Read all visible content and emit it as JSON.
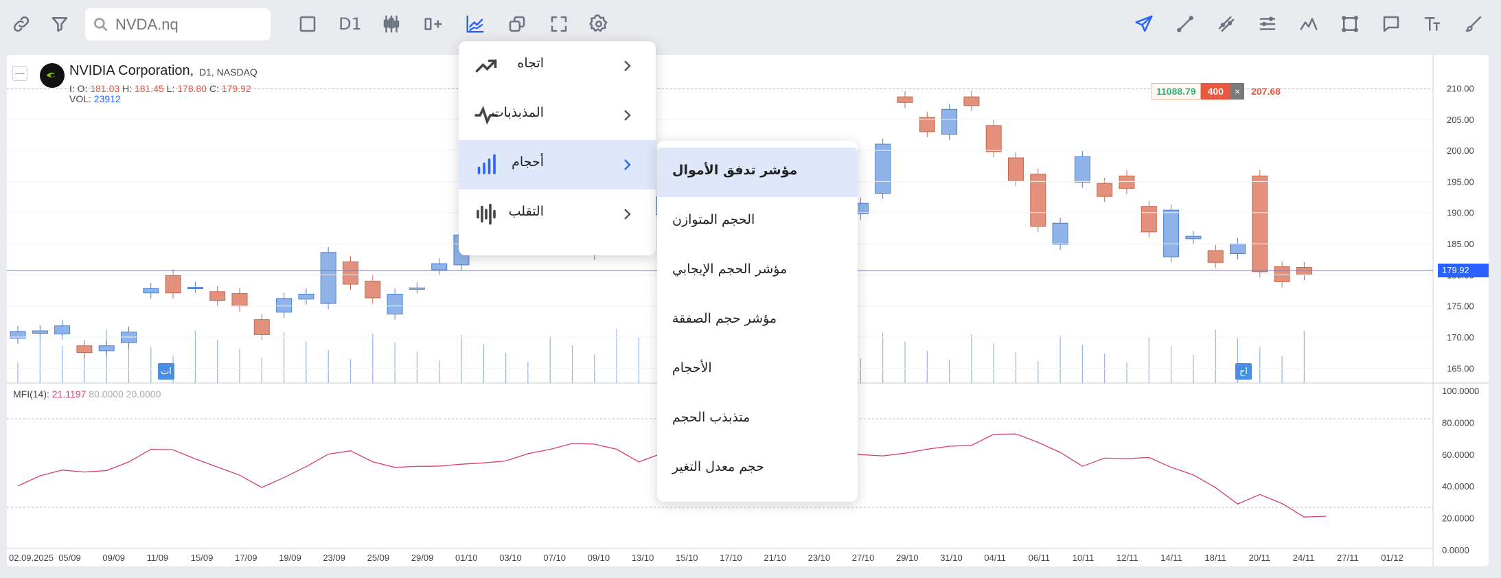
{
  "toolbar": {
    "search_placeholder": "NVDA.nq",
    "timeframe": "D1"
  },
  "legend": {
    "symbol_name": "NVIDIA Corporation,",
    "meta": "D1, NASDAQ",
    "ohlc": {
      "o_label": "I: O:",
      "o": "181.03",
      "h_label": "H:",
      "h": "181.45",
      "l_label": "L:",
      "l": "178.80",
      "c_label": "C:",
      "c": "179.92"
    },
    "vol_label": "VOL:",
    "vol": "23912"
  },
  "mfi_legend": {
    "label": "MFI(14):",
    "value": "21.1197",
    "upper": "80.0000",
    "lower": "20.0000"
  },
  "price_box": {
    "left": "11088.79",
    "qty": "400",
    "close": "×",
    "price": "207.68"
  },
  "current_price": "179.92",
  "tags": {
    "a": "ات",
    "b": "اح"
  },
  "menu_categories": [
    {
      "label": "اتجاه",
      "icon": "trend-icon"
    },
    {
      "label": "المذبذبات",
      "icon": "oscillator-icon"
    },
    {
      "label": "أحجام",
      "icon": "volume-bars-icon"
    },
    {
      "label": "التقلب",
      "icon": "volatility-icon"
    }
  ],
  "submenu_volume": [
    "مؤشر تدفق الأموال",
    "الحجم المتوازن",
    "مؤشر الحجم الإيجابي",
    "مؤشر حجم الصفقة",
    "الأحجام",
    "متذبذب الحجم",
    "حجم معدل التغير"
  ],
  "colors": {
    "accent": "#2962ff",
    "up": "#8fb3e8",
    "down": "#e3917c",
    "mfi": "#d63c7a"
  },
  "chart_data": {
    "type": "candlestick",
    "x_labels": [
      "02.09.2025",
      "05/09",
      "09/09",
      "11/09",
      "15/09",
      "17/09",
      "19/09",
      "23/09",
      "25/09",
      "29/09",
      "01/10",
      "03/10",
      "07/10",
      "09/10",
      "13/10",
      "15/10",
      "17/10",
      "21/10",
      "23/10",
      "27/10",
      "29/10",
      "31/10",
      "04/11",
      "06/11",
      "10/11",
      "12/11",
      "14/11",
      "18/11",
      "20/11",
      "24/11",
      "27/11",
      "01/12"
    ],
    "y_price_ticks": [
      "210.00",
      "205.00",
      "200.00",
      "195.00",
      "190.00",
      "185.00",
      "180.00",
      "175.00",
      "170.00",
      "165.00"
    ],
    "y_mfi_ticks": [
      "100.0000",
      "80.0000",
      "60.0000",
      "40.0000",
      "20.0000",
      "0.0000"
    ],
    "price_range": [
      162.5,
      212.7
    ],
    "mfi_range": [
      0,
      100
    ],
    "candles": [
      [
        169.8,
        170.9
      ],
      [
        170.6,
        171.0
      ],
      [
        170.5,
        171.8
      ],
      [
        168.6,
        167.5
      ],
      [
        167.8,
        168.6
      ],
      [
        169.1,
        170.8
      ],
      [
        177.1,
        177.8
      ],
      [
        179.9,
        177.1
      ],
      [
        178.0,
        178.0
      ],
      [
        177.3,
        175.9
      ],
      [
        177.0,
        175.0
      ],
      [
        172.8,
        170.4
      ],
      [
        174.0,
        176.2
      ],
      [
        176.1,
        176.9
      ],
      [
        175.4,
        183.6
      ],
      [
        182.1,
        178.5
      ],
      [
        179.0,
        176.3
      ],
      [
        173.7,
        176.9
      ],
      [
        177.9,
        177.9
      ],
      [
        180.8,
        181.8
      ],
      [
        181.6,
        186.4
      ],
      [
        184.8,
        185.4
      ],
      [
        186.7,
        188.3
      ],
      [
        188.3,
        187.2
      ],
      [
        185.5,
        186.8
      ],
      [
        186.9,
        187.1
      ],
      [
        183.3,
        186.1
      ],
      [
        186.5,
        186.3
      ],
      [
        190.1,
        186.4
      ],
      [
        189.7,
        192.5
      ],
      [
        191.2,
        191.8
      ],
      [
        193.6,
        193.8
      ],
      [
        194.1,
        194.0
      ],
      [
        193.8,
        195.2
      ],
      [
        191.5,
        190.0
      ],
      [
        190.0,
        190.5
      ],
      [
        191.7,
        187.8
      ],
      [
        189.5,
        189.6
      ],
      [
        189.8,
        191.5
      ],
      [
        193.1,
        201.0
      ],
      [
        208.6,
        207.7
      ],
      [
        205.3,
        203.0
      ],
      [
        202.6,
        206.6
      ],
      [
        208.6,
        207.2
      ],
      [
        204.0,
        199.8
      ],
      [
        198.8,
        195.2
      ],
      [
        196.2,
        187.8
      ],
      [
        184.9,
        188.3
      ],
      [
        194.9,
        199.0
      ],
      [
        194.7,
        192.6
      ],
      [
        195.9,
        193.9
      ],
      [
        191.0,
        186.9
      ],
      [
        182.9,
        190.4
      ],
      [
        185.8,
        186.2
      ],
      [
        183.9,
        182.0
      ],
      [
        183.4,
        185.0
      ],
      [
        195.9,
        180.5
      ],
      [
        181.3,
        178.9
      ],
      [
        181.2,
        180.0
      ]
    ],
    "mfi": [
      40.1,
      46.5,
      50.1,
      48.9,
      49.8,
      55.2,
      63.1,
      62.8,
      57.1,
      52.0,
      46.9,
      39.2,
      45.4,
      52.3,
      60.1,
      62.2,
      55.3,
      51.8,
      52.4,
      52.6,
      53.8,
      54.6,
      55.8,
      60.4,
      63.1,
      66.8,
      66.4,
      63.2,
      55.2,
      60.4,
      62.5,
      61.8,
      58.4,
      57.6,
      60.0,
      60.5,
      61.3,
      62.0,
      59.8,
      59.0,
      60.7,
      63.2,
      65.1,
      65.6,
      72.6,
      72.8,
      67.5,
      61.2,
      52.5,
      57.6,
      57.3,
      58.0,
      51.8,
      47.1,
      39.1,
      28.8,
      34.8,
      29.1,
      20.6,
      21.1
    ]
  }
}
